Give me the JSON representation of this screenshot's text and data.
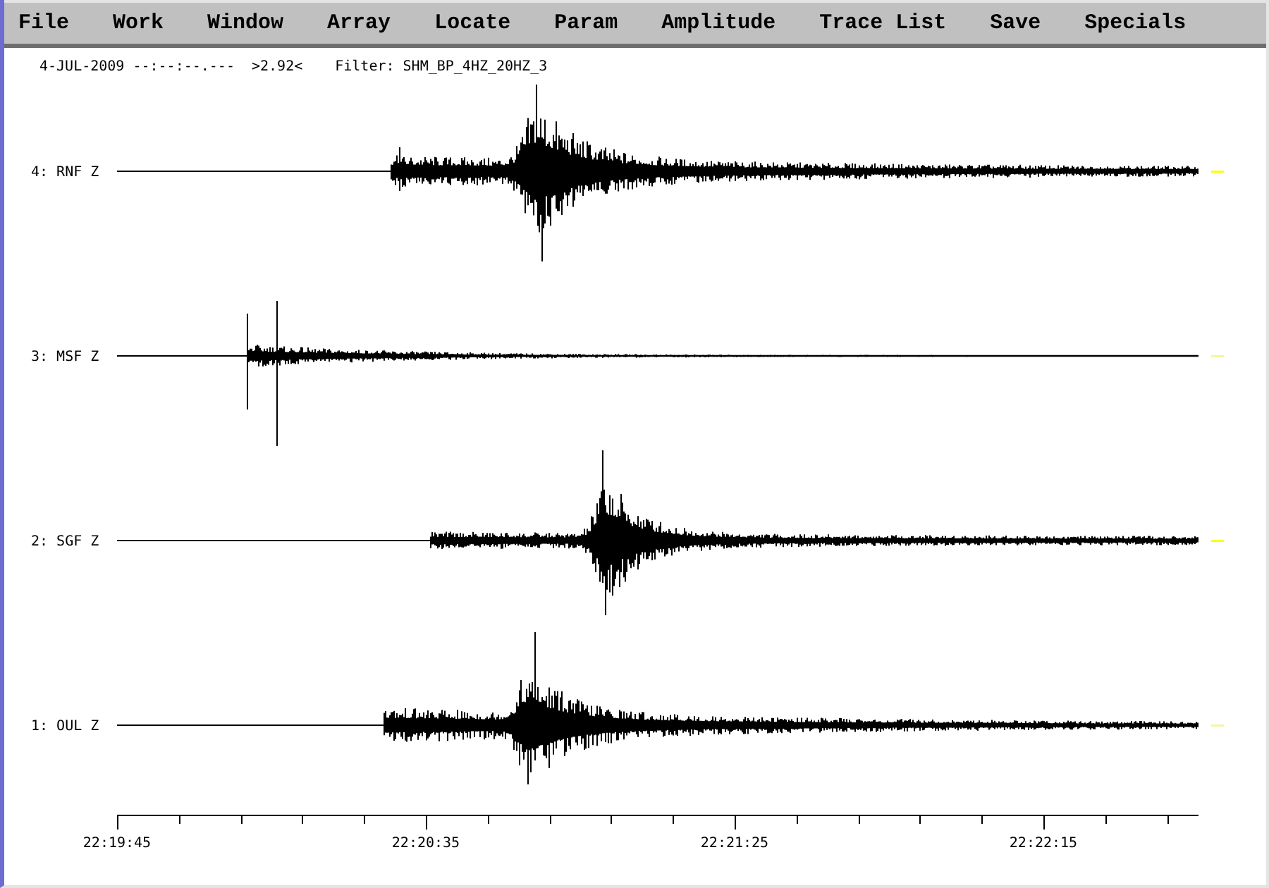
{
  "menu": [
    "File",
    "Work",
    "Window",
    "Array",
    "Locate",
    "Param",
    "Amplitude",
    "Trace List",
    "Save",
    "Specials"
  ],
  "header": {
    "date_time": "4-JUL-2009 --:--:--.---",
    "scale": ">2.92<",
    "filter": "Filter: SHM_BP_4HZ_20HZ_3"
  },
  "traces": [
    {
      "label": "4: RNF Z",
      "color": "#ffff00"
    },
    {
      "label": "3: MSF Z",
      "color": "#f5f5a0"
    },
    {
      "label": "2: SGF Z",
      "color": "#ffff00"
    },
    {
      "label": "1: OUL Z",
      "color": "#f5f5a0"
    }
  ],
  "time_axis": {
    "labels": [
      "22:19:45",
      "22:20:35",
      "22:21:25",
      "22:22:15"
    ]
  }
}
